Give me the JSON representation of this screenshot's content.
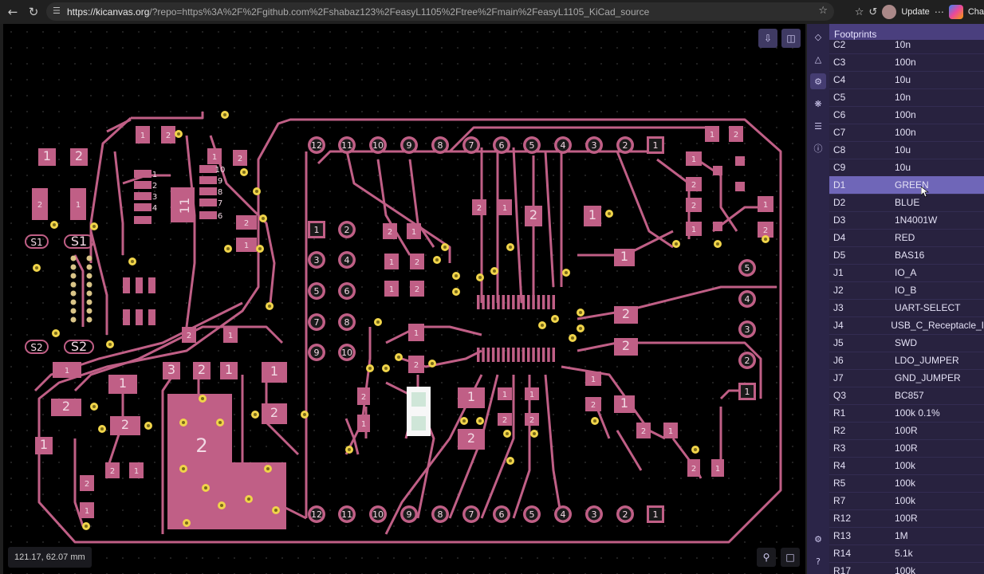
{
  "browser": {
    "url_host": "https://kicanvas.org",
    "url_rest": "/?repo=https%3A%2F%2Fgithub.com%2Fshabaz123%2FeasyL1105%2Ftree%2Fmain%2FeasyL1105_KiCad_source",
    "update_label": "Update",
    "tab_label": "Cha"
  },
  "viewer": {
    "coords": "121.17, 62.07 mm"
  },
  "panel": {
    "title": "Footprints",
    "rows": [
      {
        "ref": "C2",
        "value": "10n"
      },
      {
        "ref": "C3",
        "value": "100n"
      },
      {
        "ref": "C4",
        "value": "10u"
      },
      {
        "ref": "C5",
        "value": "10n"
      },
      {
        "ref": "C6",
        "value": "100n"
      },
      {
        "ref": "C7",
        "value": "100n"
      },
      {
        "ref": "C8",
        "value": "10u"
      },
      {
        "ref": "C9",
        "value": "10u"
      },
      {
        "ref": "D1",
        "value": "GREEN",
        "selected": true
      },
      {
        "ref": "D2",
        "value": "BLUE"
      },
      {
        "ref": "D3",
        "value": "1N4001W"
      },
      {
        "ref": "D4",
        "value": "RED"
      },
      {
        "ref": "D5",
        "value": "BAS16"
      },
      {
        "ref": "J1",
        "value": "IO_A"
      },
      {
        "ref": "J2",
        "value": "IO_B"
      },
      {
        "ref": "J3",
        "value": "UART-SELECT"
      },
      {
        "ref": "J4",
        "value": "USB_C_Receptacle_I"
      },
      {
        "ref": "J5",
        "value": "SWD"
      },
      {
        "ref": "J6",
        "value": "LDO_JUMPER"
      },
      {
        "ref": "J7",
        "value": "GND_JUMPER"
      },
      {
        "ref": "Q3",
        "value": "BC857"
      },
      {
        "ref": "R1",
        "value": "100k 0.1%"
      },
      {
        "ref": "R2",
        "value": "100R"
      },
      {
        "ref": "R3",
        "value": "100R"
      },
      {
        "ref": "R4",
        "value": "100k"
      },
      {
        "ref": "R5",
        "value": "100k"
      },
      {
        "ref": "R7",
        "value": "100k"
      },
      {
        "ref": "R12",
        "value": "100R"
      },
      {
        "ref": "R13",
        "value": "1M"
      },
      {
        "ref": "R14",
        "value": "5.1k"
      },
      {
        "ref": "R17",
        "value": "100k"
      }
    ]
  },
  "pcb": {
    "header_top": [
      "12",
      "11",
      "10",
      "9",
      "8",
      "7",
      "6",
      "5",
      "4",
      "3",
      "2",
      "1"
    ],
    "header_bottom": [
      "12",
      "11",
      "10",
      "9",
      "8",
      "7",
      "6",
      "5",
      "4",
      "3",
      "2",
      "1"
    ],
    "header_left_a": [
      "1",
      "3",
      "5",
      "7",
      "9"
    ],
    "header_left_b": [
      "2",
      "4",
      "6",
      "8",
      "10"
    ],
    "header_right": [
      "5",
      "4",
      "3",
      "2",
      "1"
    ],
    "switch_labels": [
      "S1",
      "S1",
      "S2",
      "S2"
    ],
    "big_pad_label": "2",
    "ic_label": "11",
    "colors": {
      "copper": "#c05f86",
      "drill": "#f0d44a",
      "board": "#000000"
    }
  }
}
